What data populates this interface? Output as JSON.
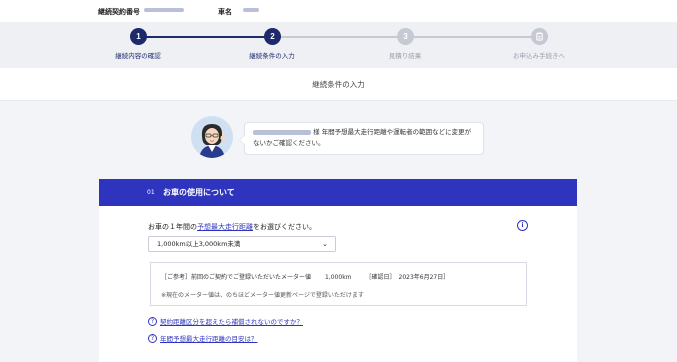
{
  "infobar": {
    "contract_label": "継続契約番号",
    "car_label": "車名"
  },
  "colors": {
    "primary": "#2f34bf",
    "inactive": "#c6c9d4",
    "track_done": "#1f2a6d"
  },
  "stepper": {
    "steps": [
      {
        "num": "1",
        "label": "継続内容の確認",
        "state": "done"
      },
      {
        "num": "2",
        "label": "継続条件の入力",
        "state": "current"
      },
      {
        "num": "3",
        "label": "見積り結果",
        "state": "upcoming"
      },
      {
        "num": "4",
        "label": "お申込み手続きへ",
        "state": "upcoming",
        "icon": "clipboard-icon"
      }
    ]
  },
  "page": {
    "title": "継続条件の入力"
  },
  "message": {
    "honorific": "様",
    "text_line1": "年間予想最大走行距離や運転者の範囲などに変更が",
    "text_line2": "ないかご確認ください。"
  },
  "section": {
    "number": "01",
    "title": "お車の使用について"
  },
  "question": {
    "prefix": "お車の１年間の",
    "link": "予想最大走行距離",
    "suffix": "をお選びください。"
  },
  "mileage_select": {
    "value": "1,000km以上3,000km未満"
  },
  "reference": {
    "label": "［ご参考］前回のご契約でご登録いただいたメーター値",
    "meter": "1,000km",
    "confirmed": "［確認日］　2023年6月27日］",
    "note": "※現在のメーター値は、のちほどメーター値更新ページで登録いただけます"
  },
  "help_links": [
    {
      "label": "契約距離区分を超えたら補償されないのですか？"
    },
    {
      "label": "年間予想最大走行距離の目安は？"
    }
  ]
}
